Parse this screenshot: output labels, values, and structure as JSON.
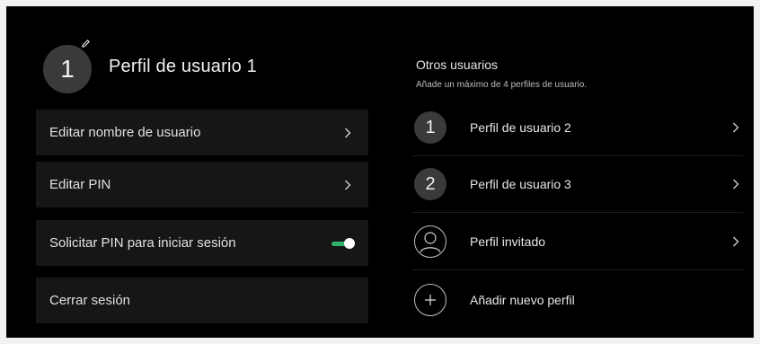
{
  "current_profile": {
    "avatar_number": "1",
    "name": "Perfil de usuario 1",
    "edit_icon": "pencil-icon"
  },
  "menu": [
    {
      "label": "Editar nombre de usuario",
      "control": "chevron"
    },
    {
      "label": "Editar PIN",
      "control": "chevron"
    },
    {
      "label": "Solicitar PIN para iniciar sesión",
      "control": "toggle",
      "toggle_on": true
    },
    {
      "label": "Cerrar sesión",
      "control": "none"
    }
  ],
  "other_users": {
    "title": "Otros usuarios",
    "subtitle": "Añade un máximo de 4 perfiles de usuario.",
    "items": [
      {
        "avatar": "1",
        "label": "Perfil de usuario 2"
      },
      {
        "avatar": "2",
        "label": "Perfil de usuario 3"
      },
      {
        "avatar_icon": "person-icon",
        "label": "Perfil invitado"
      },
      {
        "avatar_icon": "plus-icon",
        "label": "Añadir nuevo perfil"
      }
    ]
  },
  "colors": {
    "background": "#000000",
    "card": "#161616",
    "avatar": "#3a3a3a",
    "toggle_on": "#2fb36a"
  }
}
